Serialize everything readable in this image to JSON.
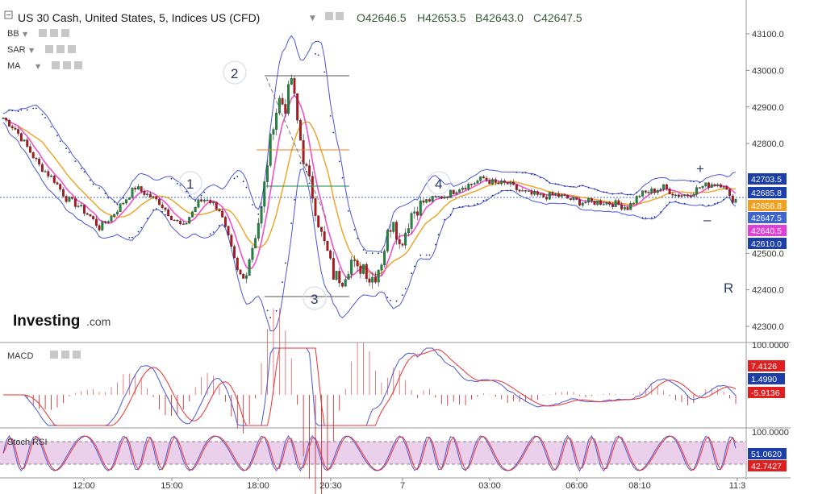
{
  "header": {
    "title": "US 30 Cash, United States, 5, Indices US (CFD)",
    "ohlc": [
      "O42646.5",
      "H42653.5",
      "B42643.0",
      "C42647.5"
    ]
  },
  "indicators": [
    "BB",
    "SAR",
    "MA"
  ],
  "watermark": {
    "brand": "Investing",
    "suffix": ".com"
  },
  "annotations": {
    "waves": [
      "1",
      "2",
      "3",
      "4"
    ],
    "plus": "+",
    "minus": "–",
    "r": "R"
  },
  "colors": {
    "up": "#1b8a3c",
    "down": "#b8151b",
    "bb": "#4a56d8",
    "ma_fast": "#f050c8",
    "ma_slow": "#f0a020",
    "macd": "#4a56d8",
    "signal": "#ee3030",
    "stoch_fill": "#e8c8e8"
  },
  "chart_data": [
    {
      "type": "candlestick",
      "panel": "price",
      "y_ticks": [
        43100,
        43000,
        42900,
        42800,
        42500,
        42400,
        42300
      ],
      "ylim": [
        42260,
        43170
      ],
      "x_ticks": [
        "12:00",
        "15:00",
        "18:00",
        "20:30",
        "7",
        "03:00",
        "06:00",
        "08:10",
        "11:3"
      ],
      "price_badges": [
        {
          "label": "42703.5",
          "color": "#1c3ea8"
        },
        {
          "label": "42685.8",
          "color": "#1c3ea8"
        },
        {
          "label": "42656.8",
          "color": "#f0a020"
        },
        {
          "label": "42647.5",
          "color": "#3d64d0"
        },
        {
          "label": "42640.5",
          "color": "#e040d8"
        },
        {
          "label": "42610.0",
          "color": "#1c3ea8"
        }
      ],
      "path": [
        [
          0,
          42870
        ],
        [
          4,
          42840
        ],
        [
          8,
          42790
        ],
        [
          12,
          42740
        ],
        [
          17,
          42700
        ],
        [
          21,
          42650
        ],
        [
          25,
          42630
        ],
        [
          29,
          42600
        ],
        [
          32,
          42570
        ],
        [
          36,
          42600
        ],
        [
          40,
          42640
        ],
        [
          44,
          42680
        ],
        [
          48,
          42660
        ],
        [
          52,
          42640
        ],
        [
          56,
          42600
        ],
        [
          60,
          42570
        ],
        [
          62,
          42600
        ],
        [
          65,
          42640
        ],
        [
          68,
          42650
        ],
        [
          72,
          42620
        ],
        [
          75,
          42540
        ],
        [
          78,
          42450
        ],
        [
          80,
          42430
        ],
        [
          83,
          42520
        ],
        [
          86,
          42620
        ],
        [
          88,
          42750
        ],
        [
          90,
          42860
        ],
        [
          92,
          42920
        ],
        [
          94,
          42900
        ],
        [
          96,
          42980
        ],
        [
          98,
          42860
        ],
        [
          100,
          42760
        ],
        [
          103,
          42660
        ],
        [
          106,
          42550
        ],
        [
          108,
          42500
        ],
        [
          110,
          42440
        ],
        [
          113,
          42430
        ],
        [
          116,
          42480
        ],
        [
          118,
          42450
        ],
        [
          120,
          42470
        ],
        [
          122,
          42430
        ],
        [
          124,
          42440
        ],
        [
          126,
          42480
        ],
        [
          128,
          42550
        ],
        [
          130,
          42600
        ],
        [
          132,
          42520
        ],
        [
          134,
          42560
        ],
        [
          136,
          42610
        ],
        [
          140,
          42640
        ],
        [
          144,
          42650
        ],
        [
          148,
          42660
        ],
        [
          152,
          42680
        ],
        [
          156,
          42690
        ],
        [
          160,
          42705
        ],
        [
          164,
          42690
        ],
        [
          168,
          42690
        ],
        [
          172,
          42670
        ],
        [
          176,
          42660
        ],
        [
          180,
          42655
        ],
        [
          184,
          42660
        ],
        [
          188,
          42650
        ],
        [
          192,
          42640
        ],
        [
          196,
          42640
        ],
        [
          200,
          42640
        ],
        [
          204,
          42635
        ],
        [
          208,
          42625
        ],
        [
          212,
          42660
        ],
        [
          216,
          42670
        ],
        [
          220,
          42680
        ],
        [
          224,
          42660
        ],
        [
          228,
          42660
        ],
        [
          232,
          42680
        ],
        [
          236,
          42690
        ],
        [
          240,
          42690
        ],
        [
          242,
          42650
        ],
        [
          244,
          42647
        ]
      ]
    },
    {
      "type": "line",
      "panel": "MACD",
      "name": "MACD",
      "y_tick_label": "100.0000",
      "value_badges": [
        {
          "label": "7.4126",
          "color": "#e02020"
        },
        {
          "label": "1.4990",
          "color": "#1c3ea8"
        },
        {
          "label": "-5.9136",
          "color": "#e02020"
        }
      ]
    },
    {
      "type": "line",
      "panel": "Stoch RSI",
      "name": "Stoch RSI",
      "y_tick_label": "100.0000",
      "value_badges": [
        {
          "label": "51.0620",
          "color": "#1c3ea8"
        },
        {
          "label": "42.7427",
          "color": "#e02020"
        }
      ]
    }
  ]
}
